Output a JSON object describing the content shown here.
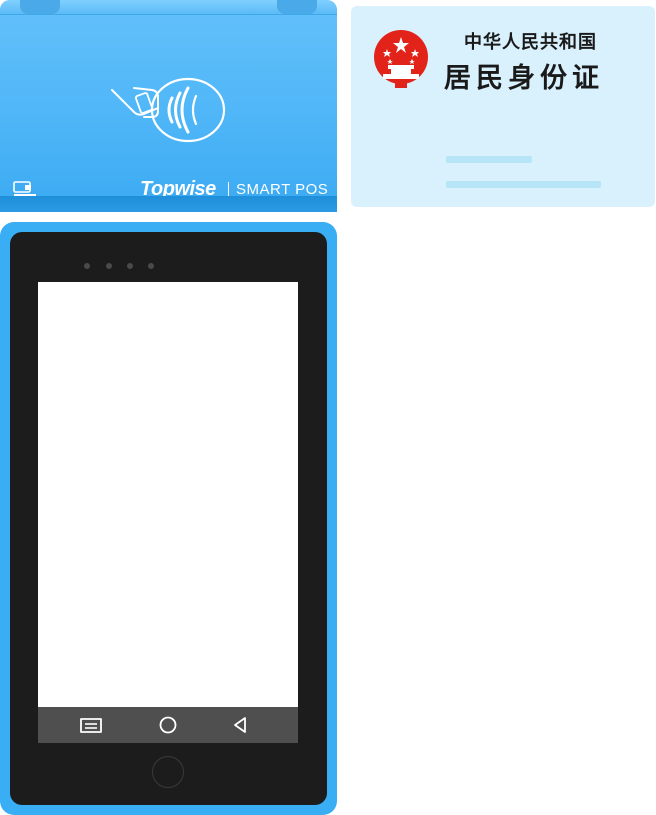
{
  "pos_terminal": {
    "brand_logo": "Topwise",
    "brand_subtitle": "SMART POS",
    "mini_logo_icon": "card-reader-icon",
    "contactless_icon": "contactless-tap-icon",
    "colors": {
      "body": "#3aaef5",
      "head": "#4db5f7",
      "face": "#1c1c1c",
      "screen": "#ffffff",
      "navbar": "#4f4f4f"
    },
    "navbar": {
      "menu_icon": "menu-icon",
      "home_icon": "home-circle-icon",
      "back_icon": "back-triangle-icon"
    }
  },
  "id_card": {
    "line1": "中华人民共和国",
    "line2": "居民身份证",
    "emblem_icon": "national-emblem-icon",
    "colors": {
      "background": "#d8f1fd",
      "emblem": "#e2231a",
      "placeholder_bar": "#b7e5f8"
    }
  }
}
